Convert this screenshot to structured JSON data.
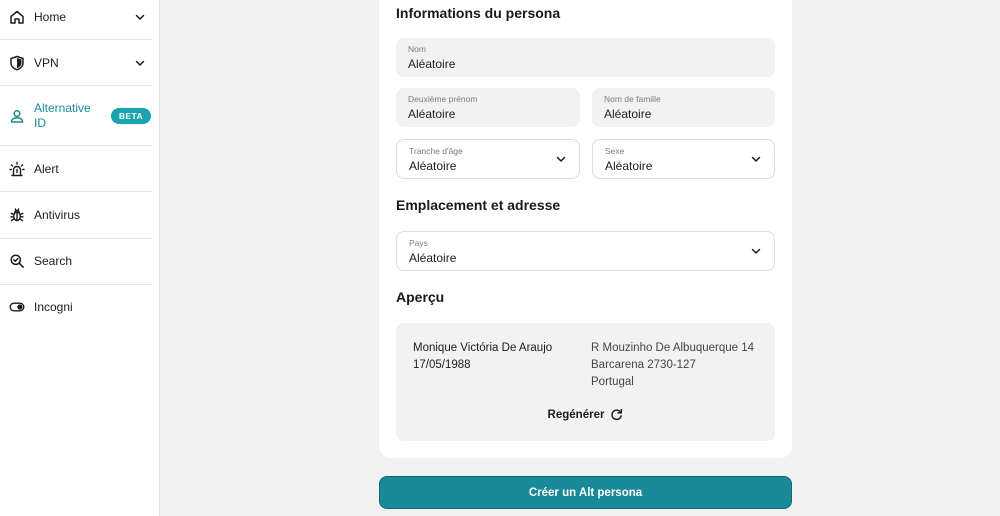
{
  "sidebar": {
    "items": [
      {
        "label": "Home",
        "icon": "home-icon"
      },
      {
        "label": "VPN",
        "icon": "shield-icon"
      },
      {
        "label": "Alternative ID",
        "line1": "Alternative",
        "line2": "ID",
        "icon": "person-icon",
        "badge": "BETA",
        "active": true
      },
      {
        "label": "Alert",
        "icon": "alert-icon"
      },
      {
        "label": "Antivirus",
        "icon": "bug-icon"
      },
      {
        "label": "Search",
        "icon": "search-icon"
      },
      {
        "label": "Incogni",
        "icon": "toggle-icon"
      }
    ]
  },
  "persona_info": {
    "title": "Informations du persona",
    "first_name": {
      "label": "Nom",
      "value": "Aléatoire"
    },
    "middle_name": {
      "label": "Deuxième prénom",
      "value": "Aléatoire"
    },
    "last_name": {
      "label": "Nom de famille",
      "value": "Aléatoire"
    },
    "age_range": {
      "label": "Tranche d'âge",
      "value": "Aléatoire"
    },
    "sex": {
      "label": "Sexe",
      "value": "Aléatoire"
    }
  },
  "location": {
    "title": "Emplacement et adresse",
    "country": {
      "label": "Pays",
      "value": "Aléatoire"
    }
  },
  "preview": {
    "title": "Aperçu",
    "name": "Monique Victória De Araujo",
    "birthdate": "17/05/1988",
    "address_line1": "R Mouzinho De Albuquerque 14",
    "address_line2": "Barcarena 2730-127",
    "address_line3": "Portugal",
    "regenerate_label": "Regénérer"
  },
  "cta": {
    "label": "Créer un Alt persona"
  },
  "colors": {
    "accent": "#1a8a98",
    "badge": "#1aa3ad",
    "active_text": "#1b8a98"
  }
}
